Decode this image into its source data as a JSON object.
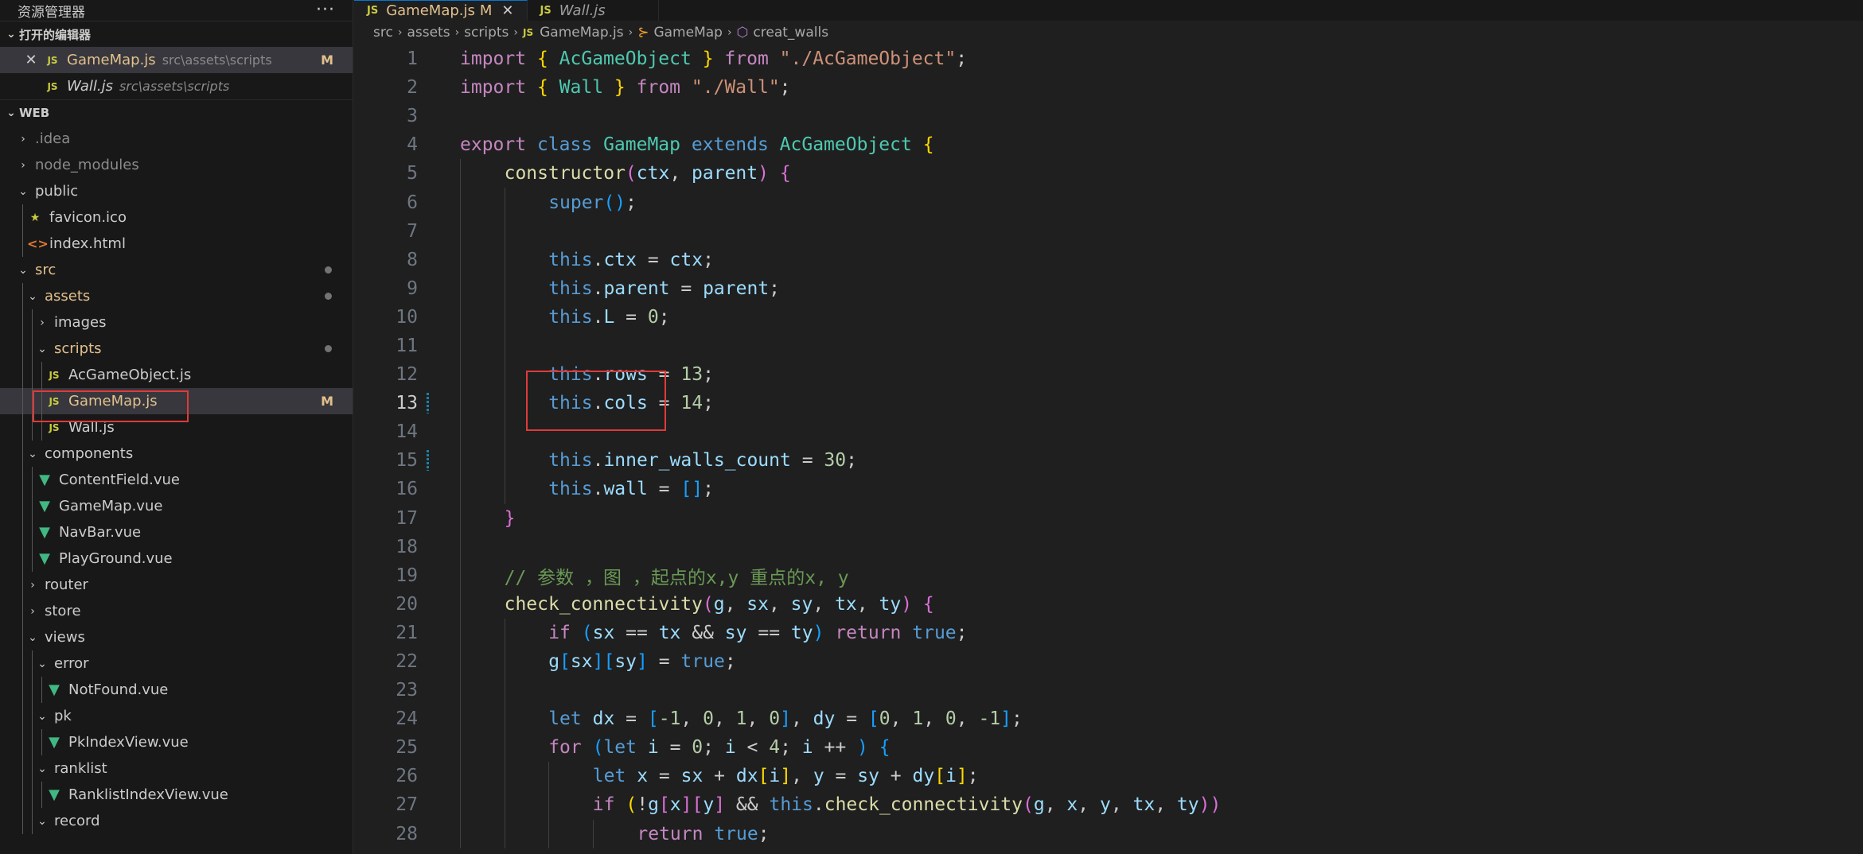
{
  "explorer": {
    "title": "资源管理器",
    "more": "···",
    "open_editors_title": "打开的编辑器",
    "open_editors": [
      {
        "name": "GameMap.js",
        "path": "src\\assets\\scripts",
        "badge": "M",
        "close": "✕"
      },
      {
        "name": "Wall.js",
        "path": "src\\assets\\scripts"
      }
    ],
    "project_title": "WEB",
    "tree": [
      {
        "label": ".idea",
        "type": "folder-closed",
        "depth": 0
      },
      {
        "label": "node_modules",
        "type": "folder-closed",
        "depth": 0
      },
      {
        "label": "public",
        "type": "folder-open",
        "depth": 0
      },
      {
        "label": "favicon.ico",
        "type": "favicon",
        "depth": 1
      },
      {
        "label": "index.html",
        "type": "html",
        "depth": 1
      },
      {
        "label": "src",
        "type": "folder-open",
        "depth": 0
      },
      {
        "label": "assets",
        "type": "folder-open",
        "depth": 1
      },
      {
        "label": "images",
        "type": "folder-closed",
        "depth": 2
      },
      {
        "label": "scripts",
        "type": "folder-open",
        "depth": 2
      },
      {
        "label": "AcGameObject.js",
        "type": "js",
        "depth": 3
      },
      {
        "label": "GameMap.js",
        "type": "js",
        "depth": 3,
        "badge": "M"
      },
      {
        "label": "Wall.js",
        "type": "js",
        "depth": 3
      },
      {
        "label": "components",
        "type": "folder-open",
        "depth": 1
      },
      {
        "label": "ContentField.vue",
        "type": "vue",
        "depth": 2
      },
      {
        "label": "GameMap.vue",
        "type": "vue",
        "depth": 2
      },
      {
        "label": "NavBar.vue",
        "type": "vue",
        "depth": 2
      },
      {
        "label": "PlayGround.vue",
        "type": "vue",
        "depth": 2
      },
      {
        "label": "router",
        "type": "folder-closed",
        "depth": 1
      },
      {
        "label": "store",
        "type": "folder-closed",
        "depth": 1
      },
      {
        "label": "views",
        "type": "folder-open",
        "depth": 1
      },
      {
        "label": "error",
        "type": "folder-open",
        "depth": 2
      },
      {
        "label": "NotFound.vue",
        "type": "vue",
        "depth": 3
      },
      {
        "label": "pk",
        "type": "folder-open",
        "depth": 2
      },
      {
        "label": "PkIndexView.vue",
        "type": "vue",
        "depth": 3
      },
      {
        "label": "ranklist",
        "type": "folder-open",
        "depth": 2
      },
      {
        "label": "RanklistIndexView.vue",
        "type": "vue",
        "depth": 3
      },
      {
        "label": "record",
        "type": "folder-open",
        "depth": 2
      }
    ]
  },
  "tabs": [
    {
      "label": "GameMap.js",
      "badge": "M",
      "close": "✕"
    },
    {
      "label": "Wall.js"
    }
  ],
  "breadcrumb": [
    "src",
    "assets",
    "scripts",
    "GameMap.js",
    "GameMap",
    "creat_walls"
  ],
  "code_lines": [
    "1",
    "2",
    "3",
    "4",
    "5",
    "6",
    "7",
    "8",
    "9",
    "10",
    "11",
    "12",
    "13",
    "14",
    "15",
    "16",
    "17",
    "18",
    "19",
    "20",
    "21",
    "22",
    "23",
    "24",
    "25",
    "26",
    "27",
    "28"
  ],
  "code": {
    "l1": [
      "import",
      "{",
      "AcGameObject",
      "}",
      "from",
      "\"./AcGameObject\"",
      ";"
    ],
    "l2": [
      "import",
      "{",
      "Wall",
      "}",
      "from",
      "\"./Wall\"",
      ";"
    ],
    "l4": [
      "export",
      "class",
      "GameMap",
      "extends",
      "AcGameObject",
      "{"
    ],
    "l5": [
      "constructor",
      "(",
      "ctx",
      ", ",
      "parent",
      ")",
      "{"
    ],
    "l6": [
      "super",
      "()",
      ";"
    ],
    "l8": [
      "this",
      ".",
      "ctx",
      " = ",
      "ctx",
      ";"
    ],
    "l9": [
      "this",
      ".",
      "parent",
      " = ",
      "parent",
      ";"
    ],
    "l10": [
      "this",
      ".",
      "L",
      " = ",
      "0",
      ";"
    ],
    "l12": [
      "this",
      ".",
      "rows",
      " = ",
      "13",
      ";"
    ],
    "l13": [
      "this",
      ".",
      "cols",
      " = ",
      "14",
      ";"
    ],
    "l15": [
      "this",
      ".",
      "inner_walls_count",
      " = ",
      "30",
      ";"
    ],
    "l16": [
      "this",
      ".",
      "wall",
      " = ",
      "[]",
      ";"
    ],
    "l17": [
      "}"
    ],
    "l19": [
      "// 参数 ，图 ，起点的x,y 重点的x, y"
    ],
    "l20": [
      "check_connectivity",
      "(",
      "g",
      ", ",
      "sx",
      ", ",
      "sy",
      ", ",
      "tx",
      ", ",
      "ty",
      ")",
      "{"
    ],
    "l21": [
      "if",
      "(",
      "sx",
      " == ",
      "tx",
      " && ",
      "sy",
      " == ",
      "ty",
      ")",
      "return",
      "true",
      ";"
    ],
    "l22": [
      "g",
      "[",
      "sx",
      "][",
      "sy",
      "]",
      " = ",
      "true",
      ";"
    ],
    "l24": [
      "let",
      "dx",
      " = ",
      "[",
      "-1",
      ", ",
      "0",
      ", ",
      "1",
      ", ",
      "0",
      "]",
      ", ",
      "dy",
      " = ",
      "[",
      "0",
      ", ",
      "1",
      ", ",
      "0",
      ", ",
      "-1",
      "]",
      ";"
    ],
    "l25": [
      "for",
      "(",
      "let",
      "i",
      " = ",
      "0",
      "; ",
      "i",
      " < ",
      "4",
      "; ",
      "i",
      " ++ ",
      ")",
      "{"
    ],
    "l26": [
      "let",
      "x",
      " = ",
      "sx",
      " + ",
      "dx",
      "[",
      "i",
      "]",
      ", ",
      "y",
      " = ",
      "sy",
      " + ",
      "dy",
      "[",
      "i",
      "]",
      ";"
    ],
    "l27": [
      "if",
      "(",
      "!",
      "g",
      "[",
      "x",
      "][",
      "y",
      "]",
      " && ",
      "this",
      ".",
      "check_connectivity",
      "(",
      "g",
      ", ",
      "x",
      ", ",
      "y",
      ", ",
      "tx",
      ", ",
      "ty",
      "))"
    ],
    "l28": [
      "return",
      "true",
      ";"
    ]
  }
}
